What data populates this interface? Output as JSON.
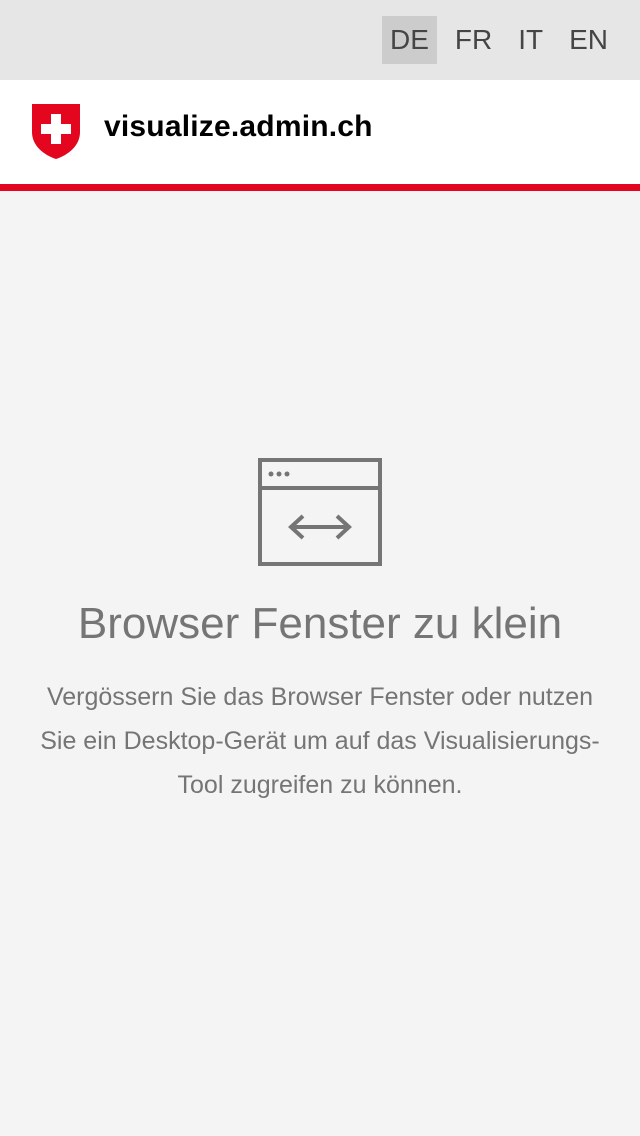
{
  "languages": [
    {
      "code": "DE",
      "active": true
    },
    {
      "code": "FR",
      "active": false
    },
    {
      "code": "IT",
      "active": false
    },
    {
      "code": "EN",
      "active": false
    }
  ],
  "header": {
    "site_title": "visualize.admin.ch"
  },
  "message": {
    "title": "Browser Fenster zu klein",
    "text": "Vergössern Sie das Browser Fenster oder nutzen Sie ein Desktop-Gerät um auf das Visualisierungs-Tool zugreifen zu können."
  },
  "colors": {
    "accent": "#e4051f",
    "text_muted": "#757575",
    "background": "#f4f4f4",
    "lang_bar": "#e6e6e6"
  },
  "icons": {
    "logo": "swiss-cross-shield-icon",
    "window": "browser-window-resize-icon"
  }
}
